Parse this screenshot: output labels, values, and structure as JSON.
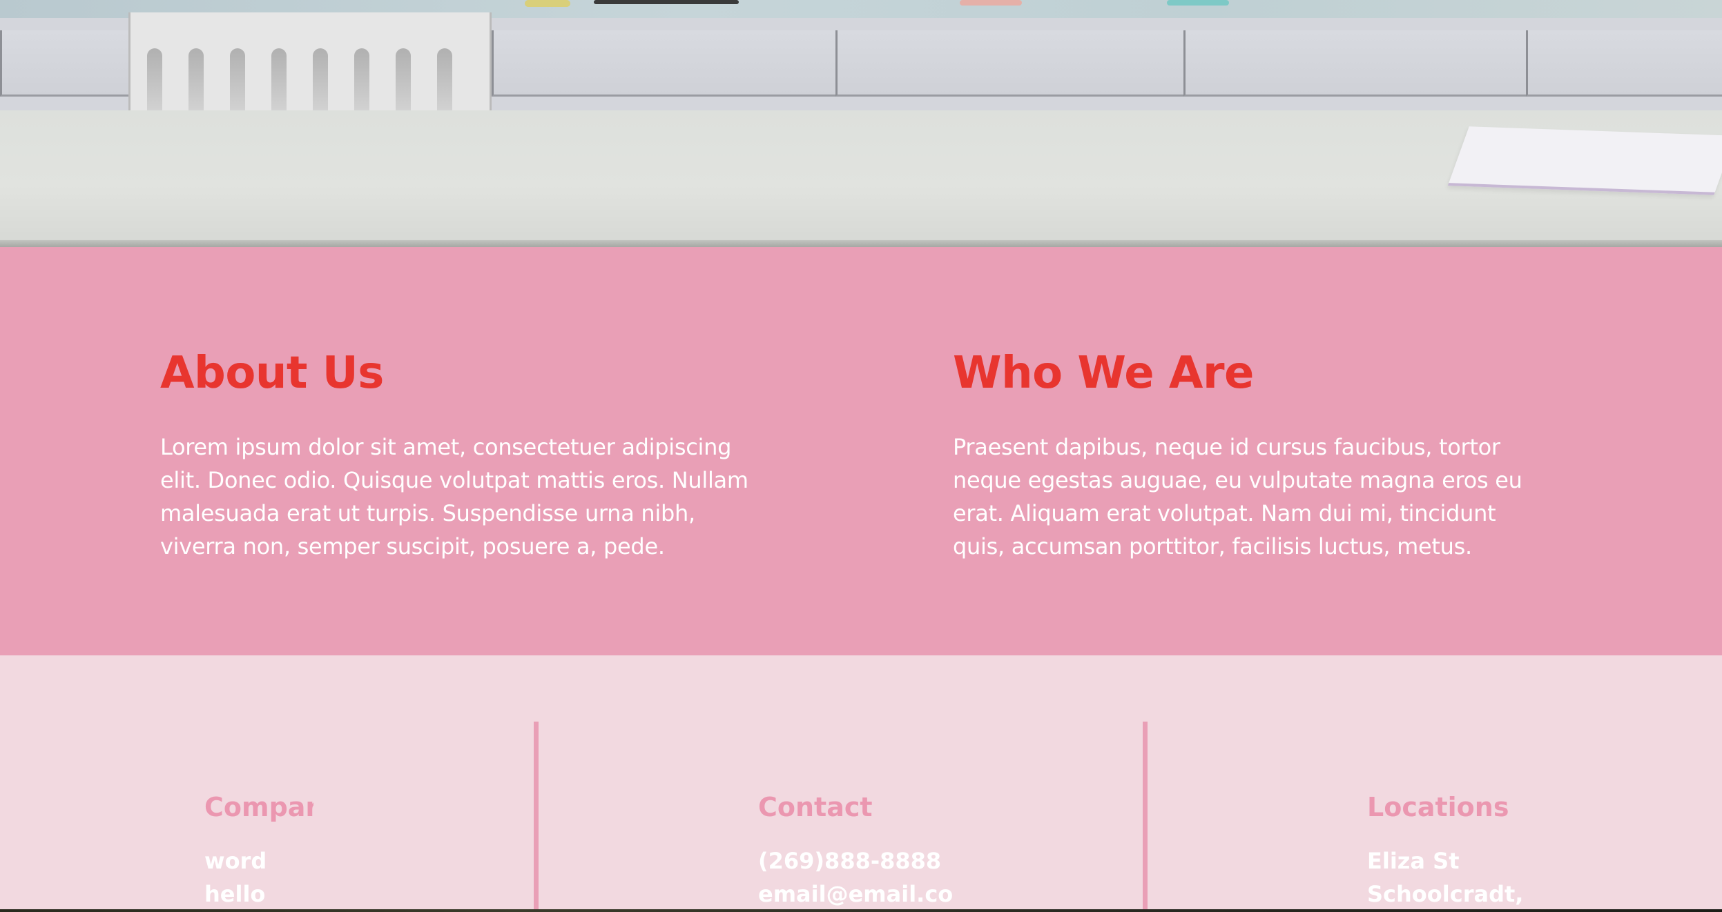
{
  "hero": {
    "image_alt": "",
    "colors": {
      "counter": "#dde0dc",
      "cabinets": "#d4d6dc"
    }
  },
  "about_section": {
    "background": "#e99fb6",
    "heading_color": "#e8352f",
    "left": {
      "title": "About Us",
      "body": "Lorem ipsum dolor sit amet, consectetuer adipiscing elit. Donec odio. Quisque volutpat mattis eros. Nullam malesuada erat ut turpis. Suspendisse urna nibh, viverra non, semper suscipit, posuere a, pede."
    },
    "right": {
      "title": "Who We Are",
      "body": "Praesent dapibus, neque id cursus faucibus, tortor neque egestas auguae, eu vulputate magna eros eu erat. Aliquam erat volutpat. Nam dui mi, tincidunt quis, accumsan porttitor, facilisis luctus, metus."
    }
  },
  "footer": {
    "background": "#f2d9e0",
    "accent": "#e99fb6",
    "company": {
      "title": "Company",
      "lines": [
        "word",
        "hello"
      ]
    },
    "contact": {
      "title": "Contact",
      "lines": [
        "(269)888-8888",
        "email@email.co"
      ]
    },
    "locations": {
      "title": "Locations",
      "lines": [
        "Eliza St",
        "Schoolcradt,"
      ]
    }
  }
}
